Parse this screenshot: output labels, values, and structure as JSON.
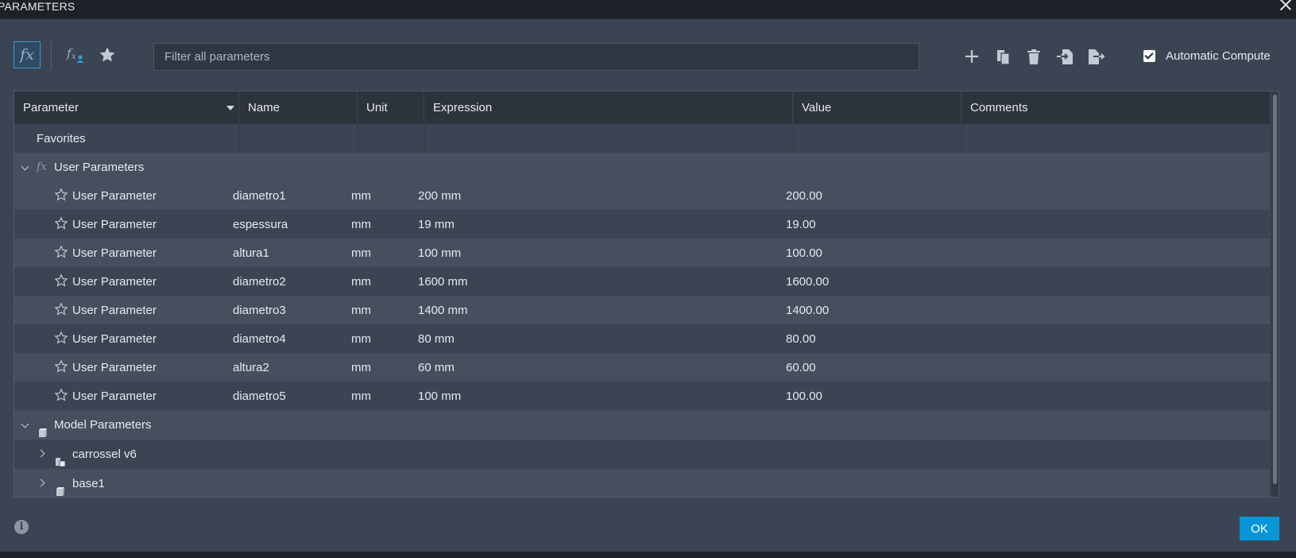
{
  "window": {
    "title": "PARAMETERS"
  },
  "toolbar": {
    "fx_glyph": "fx",
    "filter_placeholder": "Filter all parameters",
    "automatic_compute_label": "Automatic Compute",
    "automatic_compute_checked": true
  },
  "table": {
    "headers": {
      "parameter": "Parameter",
      "name": "Name",
      "unit": "Unit",
      "expression": "Expression",
      "value": "Value",
      "comments": "Comments"
    },
    "favorites_label": "Favorites",
    "user_group_label": "User Parameters",
    "model_group_label": "Model Parameters",
    "user_rows": [
      {
        "type": "User Parameter",
        "name": "diametro1",
        "unit": "mm",
        "expression": "200 mm",
        "value": "200.00"
      },
      {
        "type": "User Parameter",
        "name": "espessura",
        "unit": "mm",
        "expression": "19 mm",
        "value": "19.00"
      },
      {
        "type": "User Parameter",
        "name": "altura1",
        "unit": "mm",
        "expression": "100 mm",
        "value": "100.00"
      },
      {
        "type": "User Parameter",
        "name": "diametro2",
        "unit": "mm",
        "expression": "1600 mm",
        "value": "1600.00"
      },
      {
        "type": "User Parameter",
        "name": "diametro3",
        "unit": "mm",
        "expression": "1400 mm",
        "value": "1400.00"
      },
      {
        "type": "User Parameter",
        "name": "diametro4",
        "unit": "mm",
        "expression": "80 mm",
        "value": "80.00"
      },
      {
        "type": "User Parameter",
        "name": "altura2",
        "unit": "mm",
        "expression": "60 mm",
        "value": "60.00"
      },
      {
        "type": "User Parameter",
        "name": "diametro5",
        "unit": "mm",
        "expression": "100 mm",
        "value": "100.00"
      }
    ],
    "model_rows": [
      {
        "label": "carrossel v6"
      },
      {
        "label": "base1"
      }
    ]
  },
  "footer": {
    "info_glyph": "i",
    "ok_label": "OK"
  },
  "colors": {
    "accent": "#0696d7",
    "background": "#3b4452",
    "titlebar": "#1e2127"
  }
}
